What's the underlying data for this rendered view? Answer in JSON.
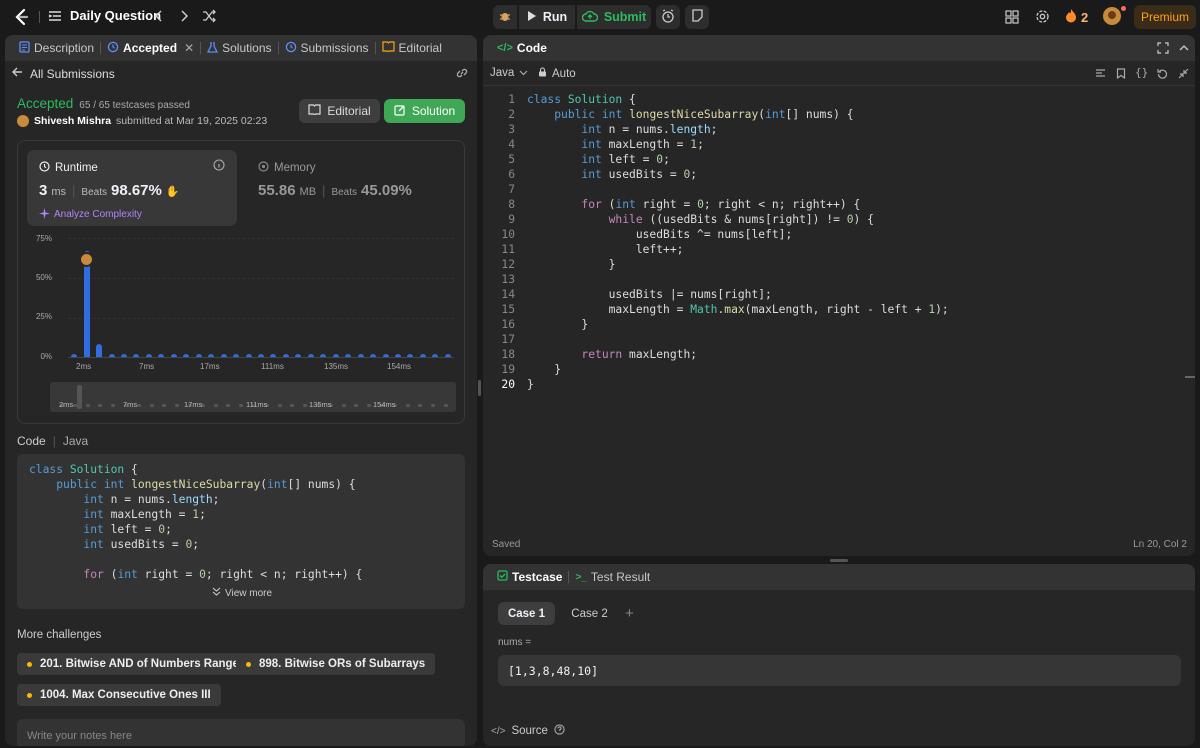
{
  "topbar": {
    "problem_list_label": "Daily Question",
    "run_label": "Run",
    "submit_label": "Submit",
    "streak_count": "2",
    "premium_label": "Premium"
  },
  "left_tabs": [
    {
      "label": "Description"
    },
    {
      "label": "Accepted"
    },
    {
      "label": "Solutions"
    },
    {
      "label": "Submissions"
    },
    {
      "label": "Editorial"
    }
  ],
  "submission": {
    "back_label": "All Submissions",
    "status": "Accepted",
    "testcases": "65 / 65 testcases passed",
    "user": "Shivesh Mishra",
    "submitted_text": "submitted at Mar 19, 2025 02:23",
    "editorial_btn": "Editorial",
    "solution_btn": "Solution",
    "runtime_label": "Runtime",
    "runtime_value": "3",
    "runtime_unit": "ms",
    "beats_label": "Beats",
    "runtime_beats": "98.67%",
    "analyze_label": "Analyze Complexity",
    "memory_label": "Memory",
    "memory_value": "55.86",
    "memory_unit": "MB",
    "memory_beats": "45.09%"
  },
  "chart_data": {
    "type": "bar",
    "ylim": [
      0,
      75
    ],
    "yticks": [
      "75%",
      "50%",
      "25%",
      "0%"
    ],
    "xticks": [
      "2ms",
      "7ms",
      "17ms",
      "111ms",
      "135ms",
      "154ms"
    ],
    "values": [
      0.5,
      66,
      8,
      0.5,
      0.5,
      0.5,
      0.5,
      0.5,
      0.5,
      0.5,
      0.5,
      0.5,
      0.5,
      0.5,
      0.5,
      0.5,
      0.5,
      0.5,
      0.5,
      0.5,
      0.5,
      0.5,
      0.5,
      0.5,
      0.5,
      0.5,
      0.5,
      0.5,
      0.5,
      0.5,
      0.5
    ],
    "highlight_index": 1,
    "bar_color": "#2f6de0"
  },
  "code_section": {
    "title": "Code",
    "lang": "Java",
    "view_more": "View more"
  },
  "code_preview": [
    "class Solution {",
    "    public int longestNiceSubarray(int[] nums) {",
    "        int n = nums.length;",
    "        int maxLength = 1;",
    "        int left = 0;",
    "        int usedBits = 0;",
    "",
    "        for (int right = 0; right < n; right++) {"
  ],
  "challenges": {
    "title": "More challenges",
    "items": [
      "201. Bitwise AND of Numbers Range",
      "898. Bitwise ORs of Subarrays",
      "1004. Max Consecutive Ones III"
    ]
  },
  "notes_placeholder": "Write your notes here",
  "editor": {
    "title": "Code",
    "language": "Java",
    "mode": "Auto",
    "saved": "Saved",
    "position": "Ln 20, Col 2",
    "lines": [
      "class Solution {",
      "    public int longestNiceSubarray(int[] nums) {",
      "        int n = nums.length;",
      "        int maxLength = 1;",
      "        int left = 0;",
      "        int usedBits = 0;",
      "",
      "        for (int right = 0; right < n; right++) {",
      "            while ((usedBits & nums[right]) != 0) {",
      "                usedBits ^= nums[left];",
      "                left++;",
      "            }",
      "",
      "            usedBits |= nums[right];",
      "            maxLength = Math.max(maxLength, right - left + 1);",
      "        }",
      "",
      "        return maxLength;",
      "    }",
      "}"
    ]
  },
  "testcase": {
    "tab_label": "Testcase",
    "result_label": "Test Result",
    "cases": [
      "Case 1",
      "Case 2"
    ],
    "var_label": "nums =",
    "var_value": "[1,3,8,48,10]",
    "source_label": "Source"
  }
}
